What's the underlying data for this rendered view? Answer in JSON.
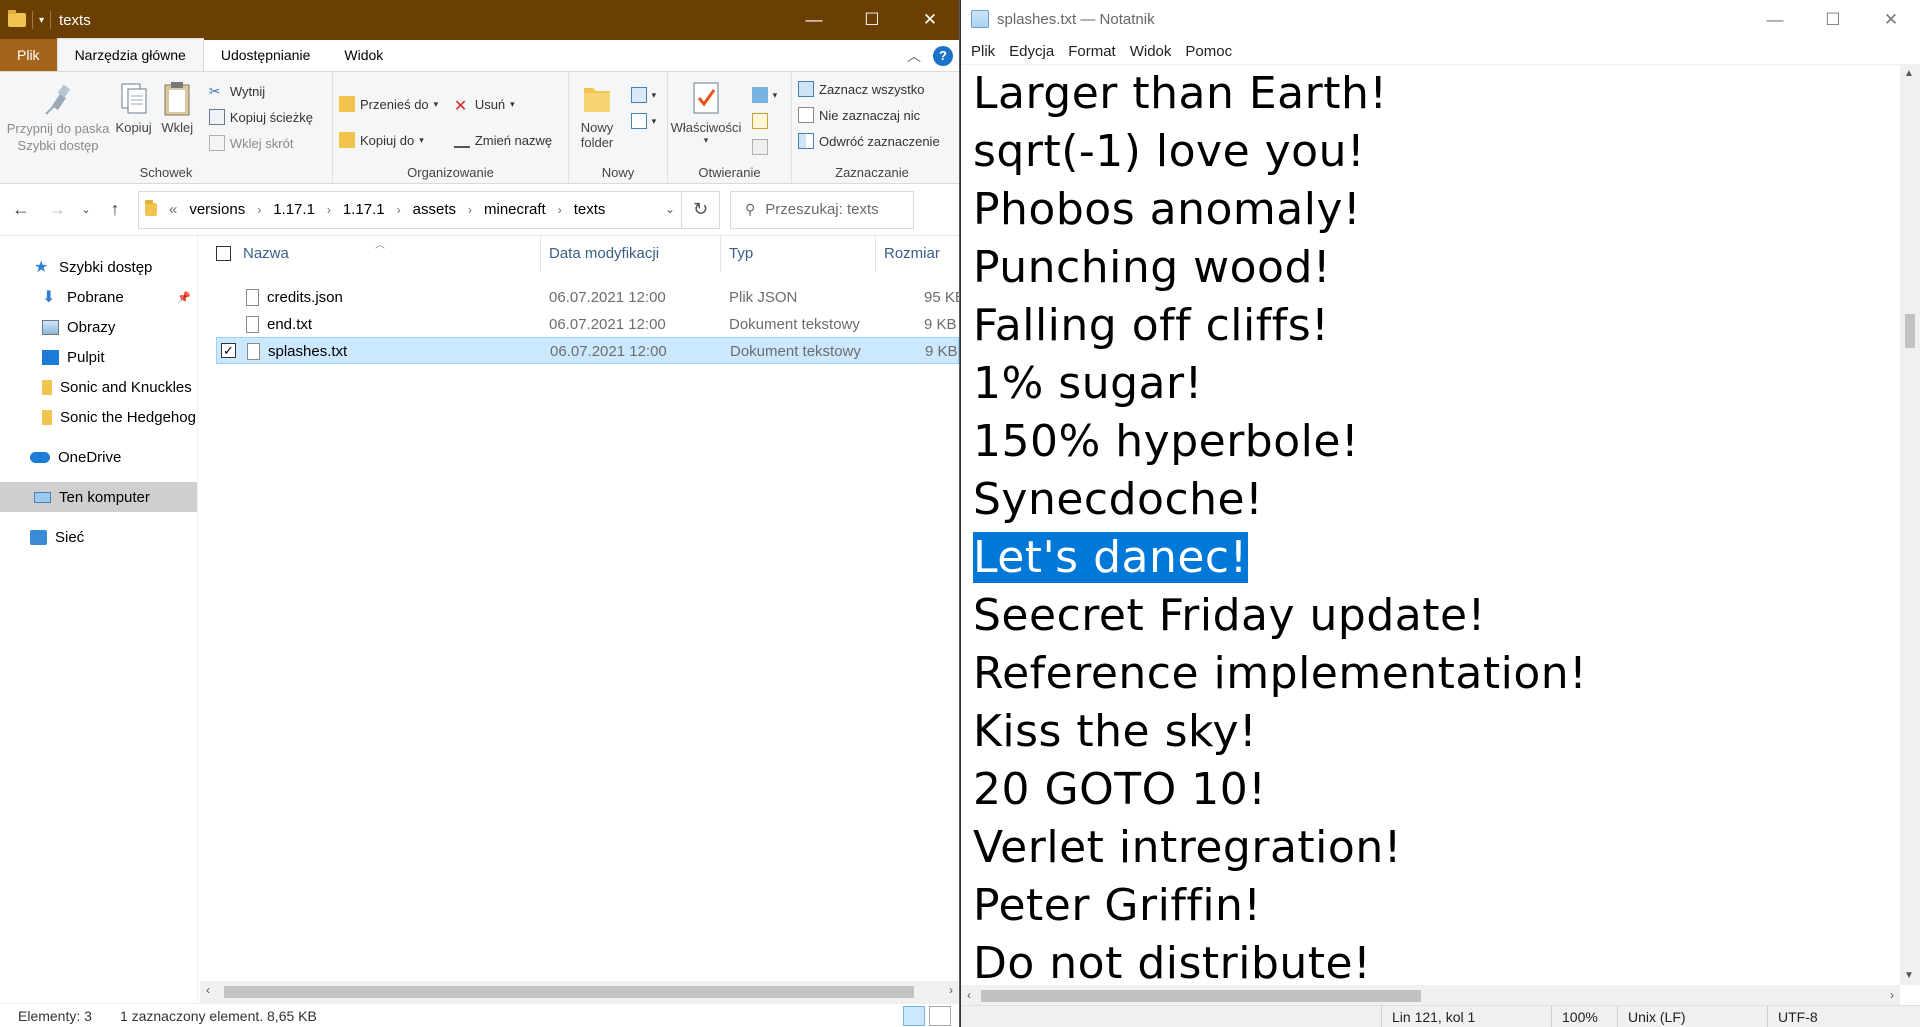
{
  "explorer": {
    "title": "texts",
    "ribbon_tabs": [
      "Plik",
      "Narzędzia główne",
      "Udostępnianie",
      "Widok"
    ],
    "help": "?",
    "groups": {
      "schowek": {
        "label": "Schowek",
        "pin": "Przypnij do paska Szybki dostęp",
        "copy": "Kopiuj",
        "paste": "Wklej",
        "cut": "Wytnij",
        "copy_path": "Kopiuj ścieżkę",
        "paste_shortcut": "Wklej skrót"
      },
      "organizowanie": {
        "label": "Organizowanie",
        "move_to": "Przenieś do",
        "copy_to": "Kopiuj do",
        "delete": "Usuń",
        "rename": "Zmień nazwę"
      },
      "nowy": {
        "label": "Nowy",
        "new_folder_1": "Nowy",
        "new_folder_2": "folder"
      },
      "otwieranie": {
        "label": "Otwieranie",
        "properties": "Właściwości"
      },
      "zaznaczanie": {
        "label": "Zaznaczanie",
        "select_all": "Zaznacz wszystko",
        "select_none": "Nie zaznaczaj nic",
        "invert": "Odwróć zaznaczenie"
      }
    },
    "breadcrumb": [
      "versions",
      "1.17.1",
      "1.17.1",
      "assets",
      "minecraft",
      "texts"
    ],
    "breadcrumb_overflow": "«",
    "search_placeholder": "Przeszukaj: texts",
    "nav_pane": {
      "quick_access": "Szybki dostęp",
      "items": [
        "Pobrane",
        "Obrazy",
        "Pulpit",
        "Sonic and Knuckles",
        "Sonic the Hedgehog"
      ],
      "onedrive": "OneDrive",
      "this_pc": "Ten komputer",
      "network": "Sieć"
    },
    "columns": [
      "Nazwa",
      "Data modyfikacji",
      "Typ",
      "Rozmiar"
    ],
    "files": [
      {
        "name": "credits.json",
        "date": "06.07.2021 12:00",
        "type": "Plik JSON",
        "size": "95 KB",
        "selected": false
      },
      {
        "name": "end.txt",
        "date": "06.07.2021 12:00",
        "type": "Dokument tekstowy",
        "size": "9 KB",
        "selected": false
      },
      {
        "name": "splashes.txt",
        "date": "06.07.2021 12:00",
        "type": "Dokument tekstowy",
        "size": "9 KB",
        "selected": true
      }
    ],
    "status": {
      "count": "Elementy: 3",
      "selection": "1 zaznaczony element. 8,65 KB"
    }
  },
  "notepad": {
    "title": "splashes.txt — Notatnik",
    "menu": [
      "Plik",
      "Edycja",
      "Format",
      "Widok",
      "Pomoc"
    ],
    "lines": [
      "Larger than Earth!",
      "sqrt(-1) love you!",
      "Phobos anomaly!",
      "Punching wood!",
      "Falling off cliffs!",
      "1% sugar!",
      "150% hyperbole!",
      "Synecdoche!",
      "Let's danec!",
      "Seecret Friday update!",
      "Reference implementation!",
      "Kiss the sky!",
      "20 GOTO 10!",
      "Verlet intregration!",
      "Peter Griffin!",
      "Do not distribute!"
    ],
    "highlighted_line": "Let's danec!",
    "status": {
      "position": "Lin 121, kol 1",
      "zoom": "100%",
      "line_ending": "Unix (LF)",
      "encoding": "UTF-8"
    }
  },
  "colors": {
    "explorer_titlebar": "#6b3f04",
    "file_tab": "#a4641a",
    "selection": "#cce8ff",
    "text_highlight": "#0078d7"
  }
}
